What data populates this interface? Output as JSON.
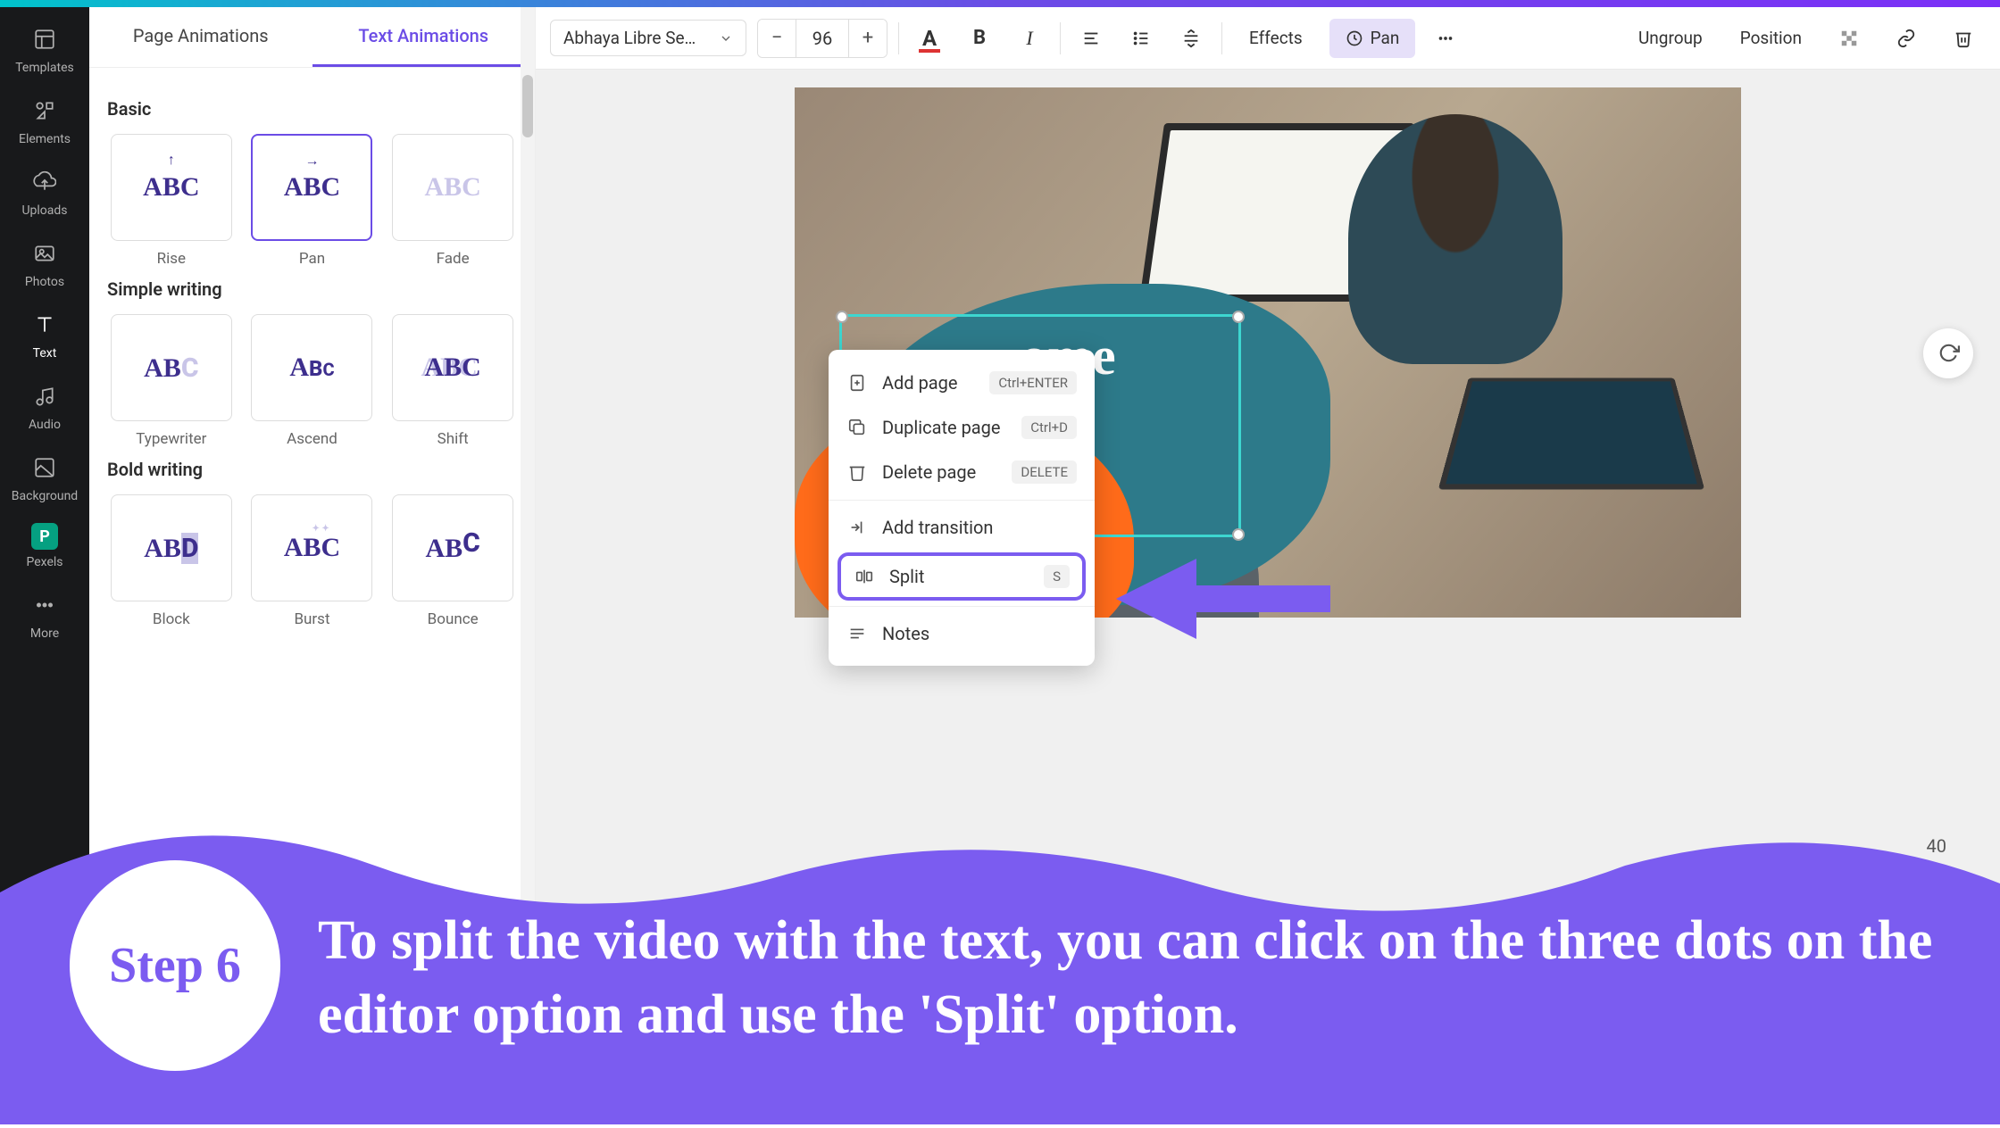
{
  "sidebar": {
    "items": [
      {
        "label": "Templates"
      },
      {
        "label": "Elements"
      },
      {
        "label": "Uploads"
      },
      {
        "label": "Photos"
      },
      {
        "label": "Text"
      },
      {
        "label": "Audio"
      },
      {
        "label": "Background"
      },
      {
        "label": "Pexels"
      },
      {
        "label": "More"
      }
    ]
  },
  "tabs": {
    "page": "Page Animations",
    "text": "Text Animations"
  },
  "animations": {
    "basic": {
      "title": "Basic",
      "items": [
        {
          "name": "Rise"
        },
        {
          "name": "Pan"
        },
        {
          "name": "Fade"
        }
      ]
    },
    "simple": {
      "title": "Simple writing",
      "items": [
        {
          "name": "Typewriter"
        },
        {
          "name": "Ascend"
        },
        {
          "name": "Shift"
        }
      ]
    },
    "bold": {
      "title": "Bold writing",
      "items": [
        {
          "name": "Block"
        },
        {
          "name": "Burst"
        },
        {
          "name": "Bounce"
        }
      ]
    }
  },
  "toolbar": {
    "font": "Abhaya Libre Se…",
    "size": "96",
    "effects": "Effects",
    "pan": "Pan",
    "ungroup": "Ungroup",
    "position": "Position"
  },
  "canvas": {
    "text_fragment": "ome"
  },
  "context_menu": {
    "add_page": {
      "label": "Add page",
      "shortcut": "Ctrl+ENTER"
    },
    "duplicate": {
      "label": "Duplicate page",
      "shortcut": "Ctrl+D"
    },
    "delete": {
      "label": "Delete page",
      "shortcut": "DELETE"
    },
    "transition": {
      "label": "Add transition"
    },
    "split": {
      "label": "Split",
      "shortcut": "S"
    },
    "notes": {
      "label": "Notes"
    }
  },
  "zoom": "40",
  "tutorial": {
    "step": "Step 6",
    "text": "To split the video with the text, you can click on the three dots on the editor option and use the 'Split' option."
  }
}
